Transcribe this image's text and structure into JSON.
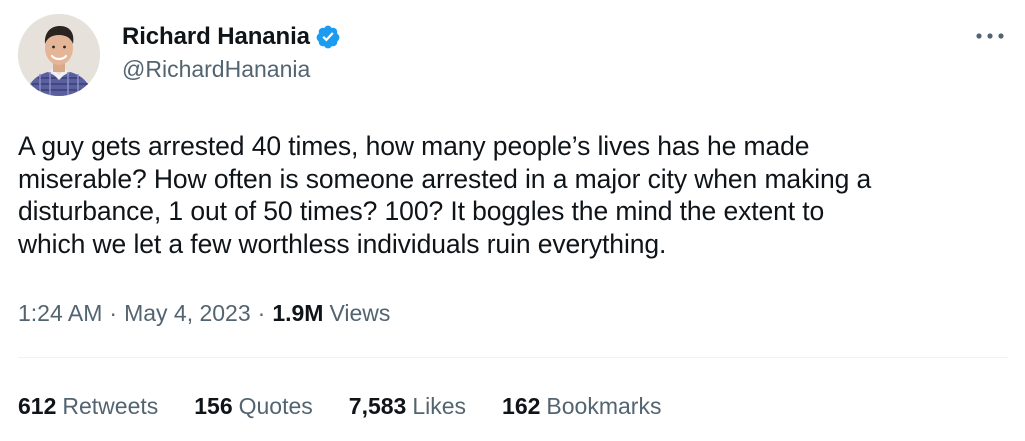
{
  "author": {
    "display_name": "Richard Hanania",
    "handle": "@RichardHanania",
    "verified": true,
    "verified_color": "#1d9bf0",
    "avatar_icon": "profile-photo"
  },
  "more_icon": "ellipsis-icon",
  "tweet": {
    "lines": [
      "A guy gets arrested 40 times, how many people’s lives has he made",
      "miserable? How often is someone arrested in a major city when making a",
      "disturbance, 1 out of 50 times? 100? It boggles the mind the extent to",
      "which we let a few worthless individuals ruin everything."
    ]
  },
  "meta": {
    "time": "1:24 AM",
    "separator": "·",
    "date": "May 4, 2023",
    "views_count": "1.9M",
    "views_label": "Views"
  },
  "stats": [
    {
      "count": "612",
      "label": "Retweets"
    },
    {
      "count": "156",
      "label": "Quotes"
    },
    {
      "count": "7,583",
      "label": "Likes"
    },
    {
      "count": "162",
      "label": "Bookmarks"
    }
  ],
  "colors": {
    "text_primary": "#0f1419",
    "text_secondary": "#536471",
    "divider": "#eff3f4"
  }
}
